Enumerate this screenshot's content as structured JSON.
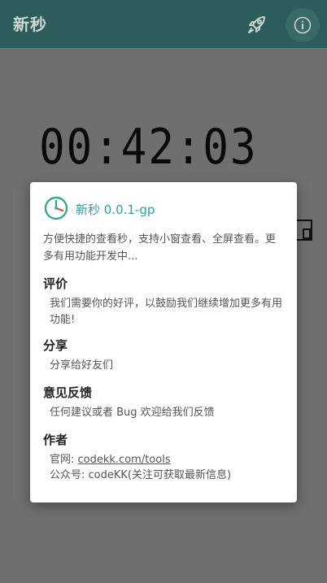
{
  "app_bar": {
    "title": "新秒",
    "rocket_icon": "rocket-icon",
    "info_icon": "info-icon"
  },
  "clock": {
    "time": "00:42:03"
  },
  "pip_icon": "picture-in-picture-icon",
  "dialog": {
    "logo_icon": "clock-icon",
    "title": "新秒 0.0.1-gp",
    "description": "方便快捷的查看秒，支持小窗查看、全屏查看。更多有用功能开发中...",
    "review_title": "评价",
    "review_text": "我们需要你的好评，以鼓励我们继续增加更多有用功能!",
    "share_title": "分享",
    "share_text": "分享给好友们",
    "feedback_title": "意见反馈",
    "feedback_text": "任何建议或者 Bug 欢迎给我们反馈",
    "author_title": "作者",
    "website_label": "官网: ",
    "website_link": "codekk.com/tools",
    "wechat_text": "公众号: codeKK(关注可获取最新信息)"
  },
  "colors": {
    "app_bar": "#2c5d5b",
    "accent": "#2aa3a0",
    "scrim": "#6f6f6f"
  }
}
